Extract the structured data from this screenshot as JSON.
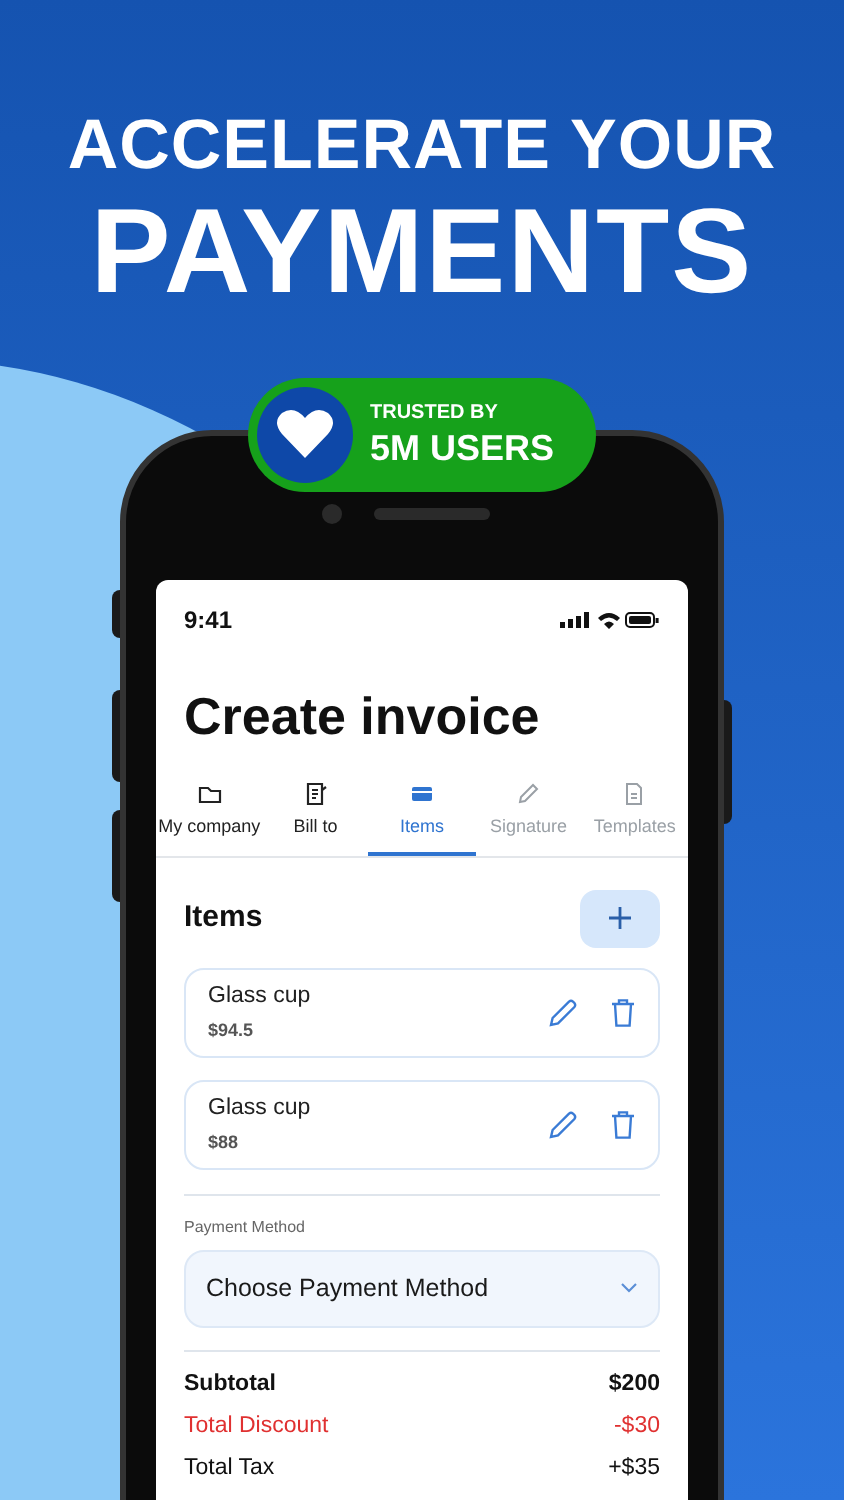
{
  "headline": {
    "line_1": "ACCELERATE YOUR",
    "line_2": "PAYMENTS"
  },
  "badge": {
    "caption": "TRUSTED BY",
    "text": "5M USERS"
  },
  "status_bar": {
    "time": "9:41"
  },
  "title": "Create invoice",
  "tabs": [
    {
      "label": "My company",
      "kind": "folder",
      "selected": false,
      "disabled": false
    },
    {
      "label": "Bill to",
      "kind": "document",
      "selected": false,
      "disabled": false
    },
    {
      "label": "Items",
      "kind": "card",
      "selected": true,
      "disabled": false
    },
    {
      "label": "Signature",
      "kind": "pencil",
      "selected": false,
      "disabled": true
    },
    {
      "label": "Templates",
      "kind": "file",
      "selected": false,
      "disabled": true
    }
  ],
  "items_section": {
    "title": "Items",
    "items": [
      {
        "name": "Glass cup",
        "price": "$94.5"
      },
      {
        "name": "Glass cup",
        "price": "$88"
      }
    ]
  },
  "payment_method": {
    "label": "Payment Method",
    "placeholder": "Choose Payment Method"
  },
  "totals": [
    {
      "kind": "subtotal",
      "label": "Subtotal",
      "value": "$200"
    },
    {
      "kind": "discount",
      "label": "Total Discount",
      "value": "-$30"
    },
    {
      "kind": "tax",
      "label": "Total Tax",
      "value": "+$35"
    }
  ]
}
